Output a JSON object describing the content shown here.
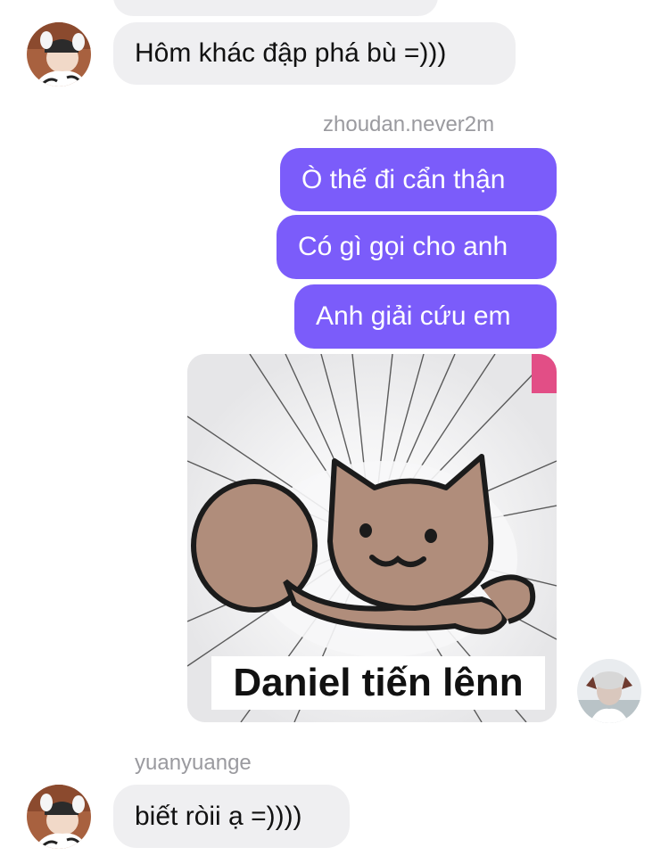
{
  "messages": {
    "m1_text": "Hôm khác đập phá bù =)))",
    "out_sender": "zhoudan.never2m",
    "out_1": "Ò thế đi cẩn thận",
    "out_2": "Có gì gọi cho anh",
    "out_3": "Anh giải cứu em",
    "sticker_caption": "Daniel tiến lênn",
    "in_sender": "yuanyuange",
    "m_last_text": "biết ròii ạ =))))"
  },
  "colors": {
    "outgoing_bubble": "#7b5cfa",
    "incoming_bubble": "#efeff1",
    "sender_name": "#9a9a9f"
  },
  "icons": {
    "contact_avatar": "avatar-photo",
    "own_avatar": "avatar-photo",
    "sticker": "cat-sticker"
  }
}
